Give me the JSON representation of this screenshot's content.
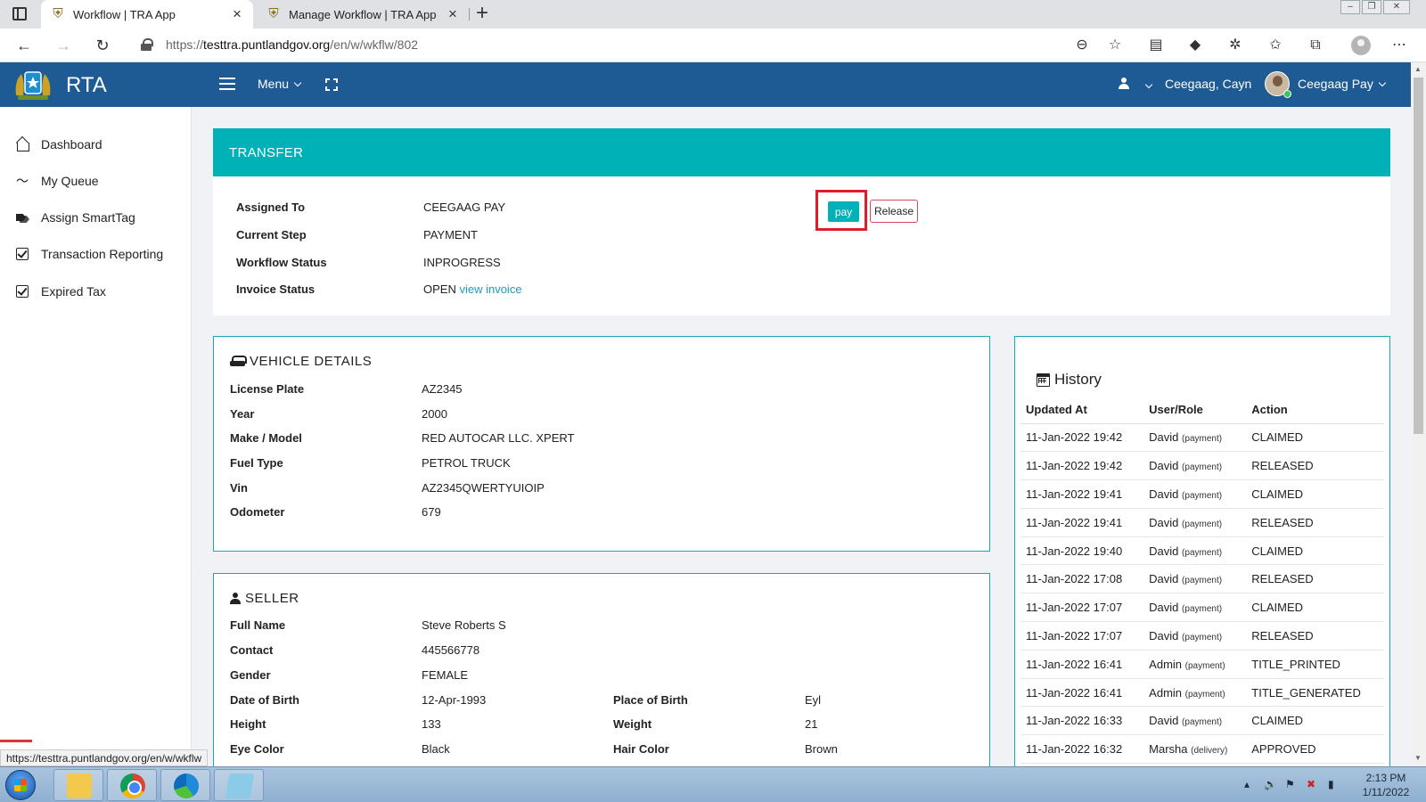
{
  "browser": {
    "tabs": [
      {
        "title": "Workflow | TRA App",
        "active": true
      },
      {
        "title": "Manage Workflow | TRA App",
        "active": false
      }
    ],
    "url_prefix": "https://",
    "url_host": "testtra.puntlandgov.org",
    "url_path": "/en/w/wkflw/802",
    "status_url": "https://testtra.puntlandgov.org/en/w/wkflw"
  },
  "header": {
    "brand": "RTA",
    "menu_label": "Menu",
    "user_name": "Ceegaag, Cayn",
    "role_name": "Ceegaag Pay"
  },
  "sidebar": {
    "items": [
      {
        "label": "Dashboard",
        "icon": "home-icon"
      },
      {
        "label": "My Queue",
        "icon": "trend-icon"
      },
      {
        "label": "Assign SmartTag",
        "icon": "tags-icon"
      },
      {
        "label": "Transaction Reporting",
        "icon": "check-square-icon"
      },
      {
        "label": "Expired Tax",
        "icon": "check-square-icon"
      }
    ]
  },
  "transfer": {
    "title": "TRANSFER",
    "assigned_to_label": "Assigned To",
    "assigned_to": "CEEGAAG PAY",
    "current_step_label": "Current Step",
    "current_step": "PAYMENT",
    "workflow_status_label": "Workflow Status",
    "workflow_status": "INPROGRESS",
    "invoice_status_label": "Invoice Status",
    "invoice_status": "OPEN",
    "view_invoice": "view invoice",
    "pay_label": "pay",
    "release_label": "Release"
  },
  "vehicle": {
    "title": "VEHICLE DETAILS",
    "rows": [
      {
        "label": "License Plate",
        "value": "AZ2345"
      },
      {
        "label": "Year",
        "value": "2000"
      },
      {
        "label": "Make / Model",
        "value": "RED AUTOCAR LLC. XPERT"
      },
      {
        "label": "Fuel Type",
        "value": "PETROL TRUCK"
      },
      {
        "label": "Vin",
        "value": "AZ2345QWERTYUIOIP"
      },
      {
        "label": "Odometer",
        "value": "679"
      }
    ]
  },
  "seller": {
    "title": "SELLER",
    "full_name_label": "Full Name",
    "full_name": "Steve Roberts S",
    "contact_label": "Contact",
    "contact": "445566778",
    "gender_label": "Gender",
    "gender": "FEMALE",
    "dob_label": "Date of Birth",
    "dob": "12-Apr-1993",
    "pob_label": "Place of Birth",
    "pob": "Eyl",
    "height_label": "Height",
    "height": "133",
    "weight_label": "Weight",
    "weight": "21",
    "eye_label": "Eye Color",
    "eye": "Black",
    "hair_label": "Hair Color",
    "hair": "Brown"
  },
  "history": {
    "title": "History",
    "columns": [
      "Updated At",
      "User/Role",
      "Action"
    ],
    "rows": [
      {
        "at": "11-Jan-2022 19:42",
        "user": "David",
        "role": "(payment)",
        "action": "CLAIMED"
      },
      {
        "at": "11-Jan-2022 19:42",
        "user": "David",
        "role": "(payment)",
        "action": "RELEASED"
      },
      {
        "at": "11-Jan-2022 19:41",
        "user": "David",
        "role": "(payment)",
        "action": "CLAIMED"
      },
      {
        "at": "11-Jan-2022 19:41",
        "user": "David",
        "role": "(payment)",
        "action": "RELEASED"
      },
      {
        "at": "11-Jan-2022 19:40",
        "user": "David",
        "role": "(payment)",
        "action": "CLAIMED"
      },
      {
        "at": "11-Jan-2022 17:08",
        "user": "David",
        "role": "(payment)",
        "action": "RELEASED"
      },
      {
        "at": "11-Jan-2022 17:07",
        "user": "David",
        "role": "(payment)",
        "action": "CLAIMED"
      },
      {
        "at": "11-Jan-2022 17:07",
        "user": "David",
        "role": "(payment)",
        "action": "RELEASED"
      },
      {
        "at": "11-Jan-2022 16:41",
        "user": "Admin",
        "role": "(payment)",
        "action": "TITLE_PRINTED"
      },
      {
        "at": "11-Jan-2022 16:41",
        "user": "Admin",
        "role": "(payment)",
        "action": "TITLE_GENERATED"
      },
      {
        "at": "11-Jan-2022 16:33",
        "user": "David",
        "role": "(payment)",
        "action": "CLAIMED"
      },
      {
        "at": "11-Jan-2022 16:32",
        "user": "Marsha",
        "role": "(delivery)",
        "action": "APPROVED"
      }
    ]
  },
  "taskbar": {
    "time": "2:13 PM",
    "date": "1/11/2022"
  },
  "colors": {
    "header_bg": "#1e5a93",
    "accent_teal": "#00b1b7",
    "highlight_red": "#e21a2a"
  }
}
